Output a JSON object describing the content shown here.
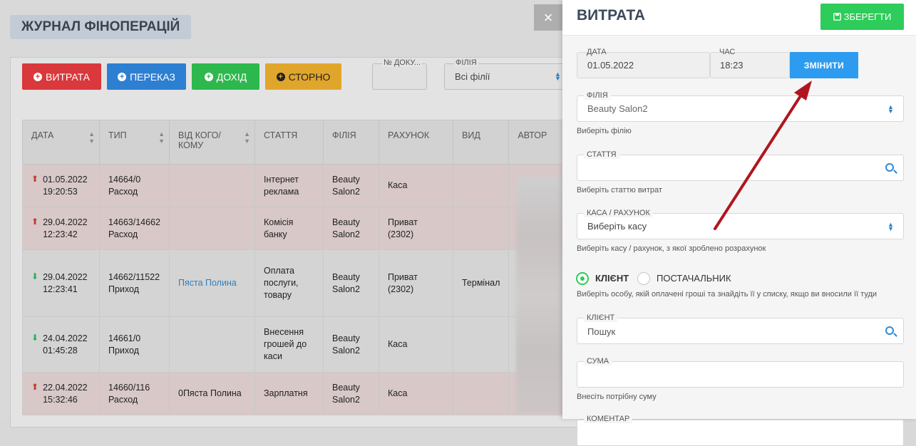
{
  "journal": {
    "title": "ЖУРНАЛ ФІНОПЕРАЦІЙ",
    "buttons": {
      "expense": "ВИТРАТА",
      "transfer": "ПЕРЕКАЗ",
      "income": "ДОХІД",
      "storno": "СТОРНО"
    },
    "filters": {
      "doc_label": "№ ДОКУ...",
      "branch_label": "ФІЛІЯ",
      "branch_value": "Всі філії"
    },
    "columns": [
      "ДАТА",
      "ТИП",
      "ВІД КОГО/КОМУ",
      "СТАТТЯ",
      "ФІЛІЯ",
      "РАХУНОК",
      "ВИД",
      "АВТОР"
    ],
    "rows": [
      {
        "kind": "expense",
        "date": "01.05.2022",
        "time": "19:20:53",
        "num": "14664/0",
        "type": "Расход",
        "party": "",
        "article": "Інтернет реклама",
        "branch": "Beauty Salon2",
        "account": "Каса",
        "view": ""
      },
      {
        "kind": "expense",
        "date": "29.04.2022",
        "time": "12:23:42",
        "num": "14663/14662",
        "type": "Расход",
        "party": "",
        "article": "Комісія банку",
        "branch": "Beauty Salon2",
        "account": "Приват (2302)",
        "view": ""
      },
      {
        "kind": "income",
        "date": "29.04.2022",
        "time": "12:23:41",
        "num": "14662/11522",
        "type": "Приход",
        "party": "Пяста Полина",
        "article": "Оплата послуги, товару",
        "branch": "Beauty Salon2",
        "account": "Приват (2302)",
        "view": "Термінал"
      },
      {
        "kind": "income",
        "date": "24.04.2022",
        "time": "01:45:28",
        "num": "14661/0",
        "type": "Приход",
        "party": "",
        "article": "Внесення грошей до каси",
        "branch": "Beauty Salon2",
        "account": "Каса",
        "view": ""
      },
      {
        "kind": "expense",
        "date": "22.04.2022",
        "time": "15:32:46",
        "num": "14660/116",
        "type": "Расход",
        "party": "0Пяста Полина",
        "article": "Зарплатня",
        "branch": "Beauty Salon2",
        "account": "Каса",
        "view": ""
      }
    ]
  },
  "panel": {
    "title": "ВИТРАТА",
    "save_label": "ЗБЕРЕГТИ",
    "close_label": "×",
    "date_label": "ДАТА",
    "date_value": "01.05.2022",
    "time_label": "ЧАС",
    "time_value": "18:23",
    "change_label": "ЗМІНИТИ",
    "branch_label": "ФІЛІЯ",
    "branch_value": "Beauty Salon2",
    "branch_hint": "Виберіть філію",
    "article_label": "СТАТТЯ",
    "article_hint": "Виберіть статтю витрат",
    "account_label": "КАСА / РАХУНОК",
    "account_value": "Виберіть касу",
    "account_hint": "Виберіть касу / рахунок, з якої зроблено розрахунок",
    "radio_client": "КЛІЄНТ",
    "radio_supplier": "ПОСТАЧАЛЬНИК",
    "radio_hint": "Виберіть особу, якій оплачені гроші та знайдіть її у списку, якщо ви вносили її туди",
    "client_label": "КЛІЄНТ",
    "client_placeholder": "Пошук",
    "sum_label": "СУМА",
    "sum_hint": "Внесіть потрібну суму",
    "comment_label": "КОМЕНТАР"
  },
  "colors": {
    "expense": "#e03a3e",
    "transfer": "#2d7fd1",
    "income": "#2db84d",
    "storno": "#e6a92a",
    "save": "#2ecc5a",
    "change": "#2d9cf0",
    "arrow": "#b0151f"
  }
}
